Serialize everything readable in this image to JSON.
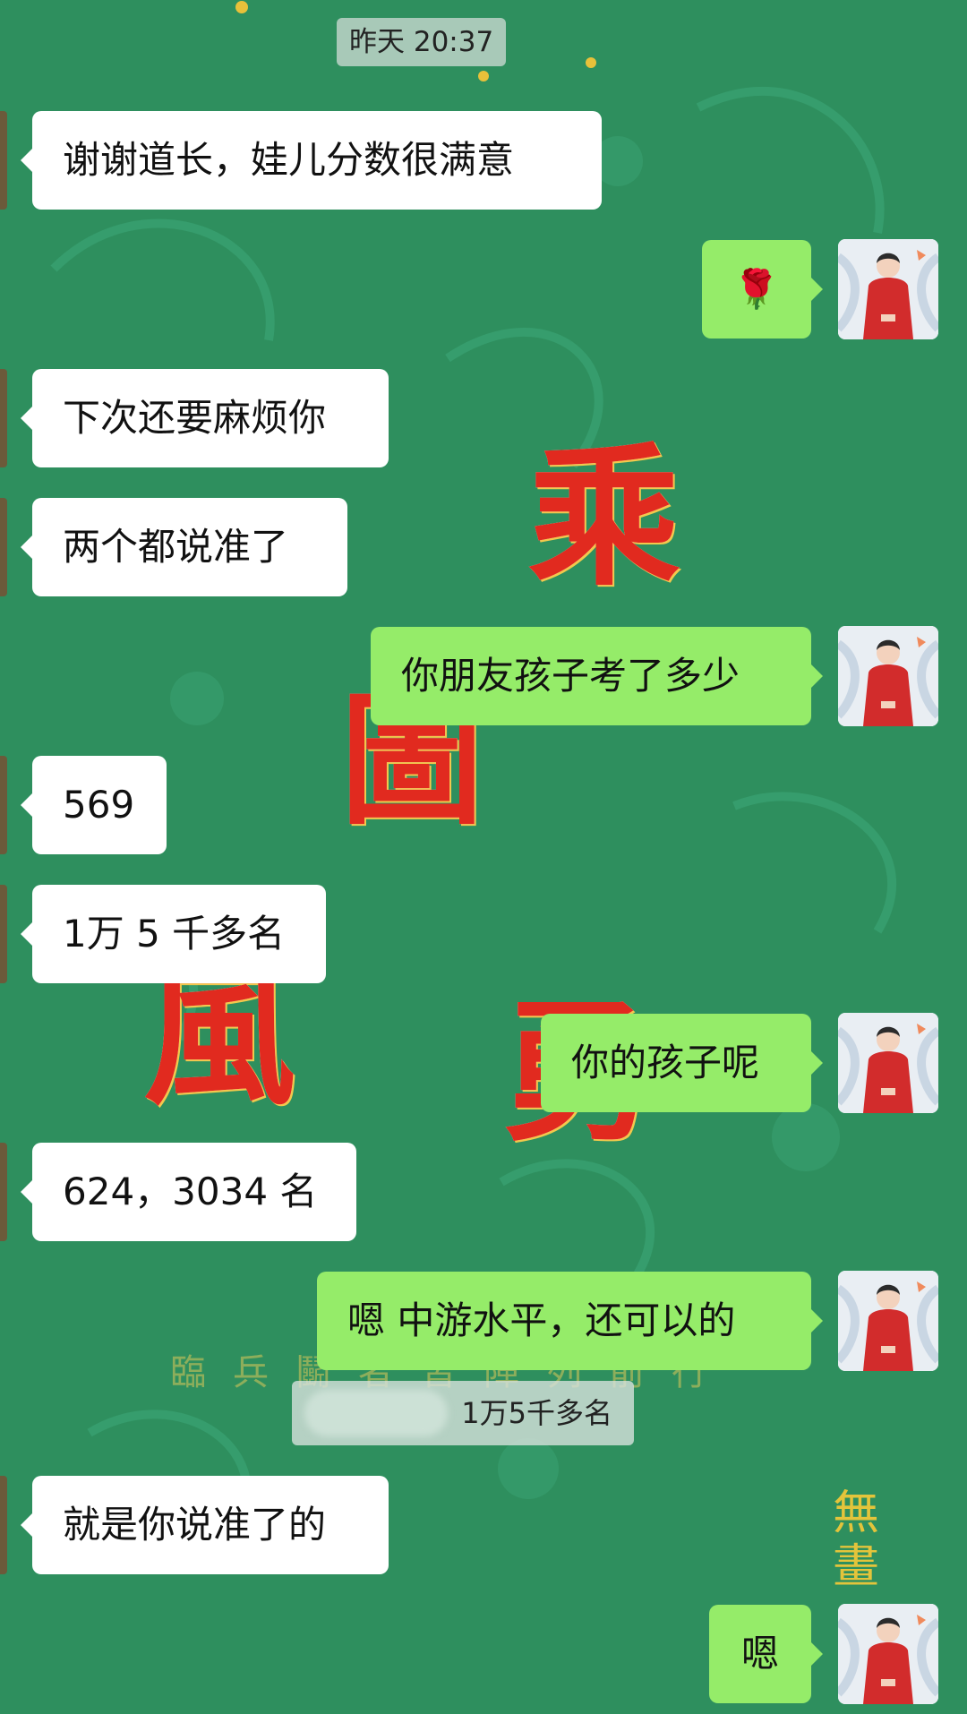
{
  "header": {
    "time": "昨天 20:37"
  },
  "messages": [
    {
      "side": "left",
      "text": "谢谢道长，娃儿分数很满意"
    },
    {
      "side": "right",
      "text": "🌹"
    },
    {
      "side": "left",
      "text": "下次还要麻烦你"
    },
    {
      "side": "left",
      "text": "两个都说准了"
    },
    {
      "side": "right",
      "text": "你朋友孩子考了多少"
    },
    {
      "side": "left",
      "text": "569"
    },
    {
      "side": "left",
      "text": "1万 5 千多名"
    },
    {
      "side": "right",
      "text": "你的孩子呢"
    },
    {
      "side": "left",
      "text": "624，3034 名"
    },
    {
      "side": "right",
      "text": "嗯 中游水平，还可以的"
    },
    {
      "side": "left",
      "text": "就是你说准了的"
    },
    {
      "side": "right",
      "text": "嗯"
    }
  ],
  "quote": {
    "text": "1万5千多名"
  },
  "background": {
    "base_color": "#2e8f5e",
    "stamp_chars": [
      "乘",
      "風",
      "圖",
      "勇"
    ],
    "faint_text": "臨兵鬭者皆陣列前行",
    "signature": "無畫"
  },
  "colors": {
    "incoming_bubble": "#ffffff",
    "outgoing_bubble": "#95ec69"
  }
}
